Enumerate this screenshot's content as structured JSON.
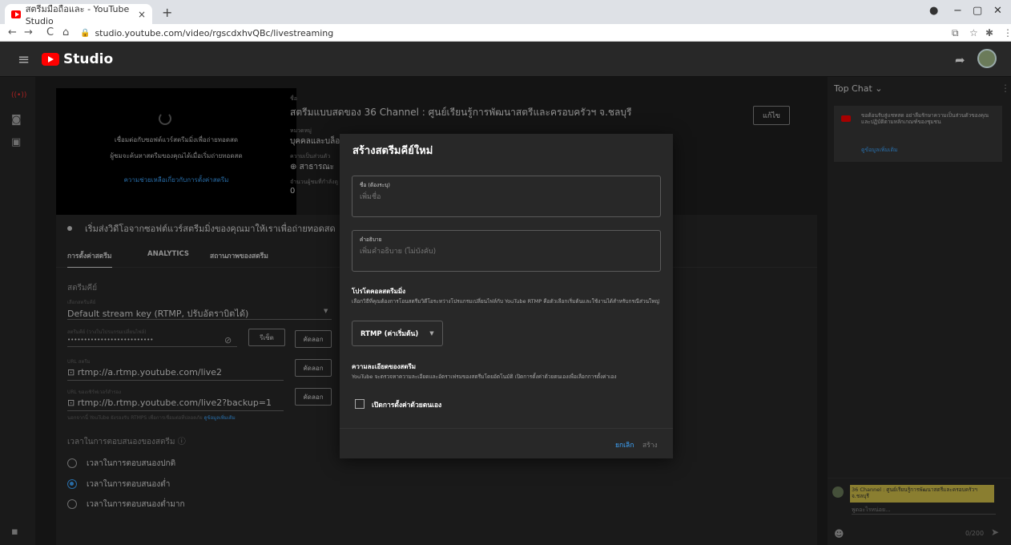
{
  "browser": {
    "tab_title": "สตรีมมือถือและ - YouTube Studio",
    "tab_close": "×",
    "new_tab": "+",
    "url": "studio.youtube.com/video/rgscdxhvQBc/livestreaming",
    "win_min": "−",
    "win_max": "▢",
    "win_close": "✕"
  },
  "header": {
    "app_name": "Studio"
  },
  "preview": {
    "line1": "เชื่อมต่อกับซอฟต์แวร์สตรีมมิ่งเพื่อถ่ายทอดสด",
    "line2": "ผู้ชมจะค้นหาสตรีมของคุณได้เมื่อเริ่มถ่ายทอดสด",
    "help_link": "ความช่วยเหลือเกี่ยวกับการตั้งค่าสตรีม"
  },
  "stream_info": {
    "title_label": "ชื่อ",
    "title": "สตรีมแบบสดของ 36 Channel : ศูนย์เรียนรู้การพัฒนาสตรีและครอบครัวฯ จ.ชลบุรี",
    "category_label": "หมวดหมู่",
    "category": "บุคคลและบล็อก",
    "privacy_label": "ความเป็นส่วนตัว",
    "privacy": "สาธารณะ",
    "viewers_label": "จำนวนผู้ชมที่กำลังดู",
    "viewers": "0",
    "edit_button": "แก้ไข"
  },
  "status_row": {
    "text": "เริ่มส่งวิดีโอจากซอฟต์แวร์สตรีมมิ่งของคุณมาให้เราเพื่อถ่ายทอดสด"
  },
  "tabs": [
    "การตั้งค่าสตรีม",
    "ANALYTICS",
    "สถานภาพของสตรีม"
  ],
  "settings": {
    "stream_key_heading": "สตรีมคีย์",
    "select_key_label": "เลือกสตรีมคีย์",
    "select_key_value": "Default stream key (RTMP, ปรับอัตราบิตได้)",
    "key_label": "สตรีมคีย์ (วางในโปรแกรมเปลี่ยนไฟล์)",
    "key_value": "••••••••••••••••••••••••••",
    "reset_button": "รีเซ็ต",
    "copy_button": "คัดลอก",
    "url_label": "URL สตรีม",
    "url_value": "rtmp://a.rtmp.youtube.com/live2",
    "backup_label": "URL ของเซิร์ฟเวอร์สำรอง",
    "backup_value": "rtmp://b.rtmp.youtube.com/live2?backup=1",
    "rtmps_note": "นอกจากนี้ YouTube ยังรองรับ RTMPS เพื่อการเชื่อมต่อที่ปลอดภัย",
    "rtmps_link": "ดูข้อมูลเพิ่มเติม",
    "latency_heading": "เวลาในการตอบสนองของสตรีม",
    "latency_options": [
      "เวลาในการตอบสนองปกติ",
      "เวลาในการตอบสนองต่ำ",
      "เวลาในการตอบสนองต่ำมาก"
    ],
    "latency_selected": 1
  },
  "chat": {
    "header": "Top Chat ⌄",
    "notice": "ขอต้อนรับสู่แชทสด อย่าลืมรักษาความเป็นส่วนตัวของคุณและปฏิบัติตามหลักเกณฑ์ของชุมชน",
    "notice_link": "ดูข้อมูลเพิ่มเติม",
    "channel_name": "36 Channel : ศูนย์เรียนรู้การพัฒนาสตรีและครอบครัวฯ จ.ชลบุรี",
    "placeholder": "พูดอะไรหน่อย...",
    "counter": "0/200"
  },
  "dialog": {
    "title": "สร้างสตรีมคีย์ใหม่",
    "name_label": "ชื่อ (ต้องระบุ)",
    "name_placeholder": "เพิ่มชื่อ",
    "desc_label": "คำอธิบาย",
    "desc_placeholder": "เพิ่มคำอธิบาย (ไม่บังคับ)",
    "protocol_heading": "โปรโตคอลสตรีมมิ่ง",
    "protocol_desc": "เลือกวิธีที่คุณต้องการโอนสตรีมวิดีโอระหว่างโปรแกรมเปลี่ยนไฟล์กับ YouTube RTMP คือตัวเลือกเริ่มต้นและใช้งานได้สำหรับกรณีส่วนใหญ่",
    "protocol_value": "RTMP (ค่าเริ่มต้น)",
    "resolution_heading": "ความละเอียดของสตรีม",
    "resolution_desc": "YouTube จะตรวจหาความละเอียดและอัตราเฟรมของสตรีมโดยอัตโนมัติ เปิดการตั้งค่าด้วยตนเองเพื่อเลือกการตั้งค่าเอง",
    "manual_label": "เปิดการตั้งค่าด้วยตนเอง",
    "cancel": "ยกเลิก",
    "create": "สร้าง"
  }
}
